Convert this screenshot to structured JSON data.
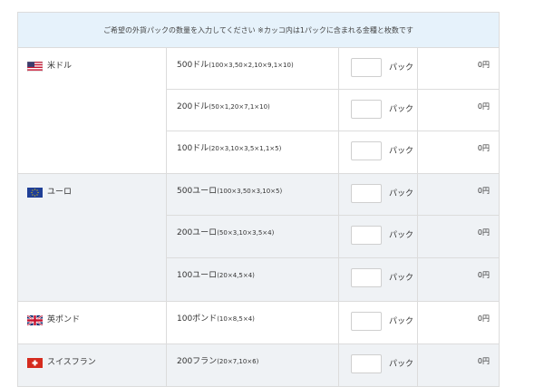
{
  "notice": "ご希望の外貨パックの数量を入力してください ※カッコ内は1パックに含まれる金種と枚数です",
  "unit_label": "パック",
  "currencies": [
    {
      "name": "米ドル",
      "flag": "us-flag-icon",
      "packs": [
        {
          "label": "500ドル",
          "detail": "(100×3,50×2,10×9,1×10)",
          "amount": "0円"
        },
        {
          "label": "200ドル",
          "detail": "(50×1,20×7,1×10)",
          "amount": "0円"
        },
        {
          "label": "100ドル",
          "detail": "(20×3,10×3,5×1,1×5)",
          "amount": "0円"
        }
      ]
    },
    {
      "name": "ユーロ",
      "flag": "eu-flag-icon",
      "packs": [
        {
          "label": "500ユーロ",
          "detail": "(100×3,50×3,10×5)",
          "amount": "0円"
        },
        {
          "label": "200ユーロ",
          "detail": "(50×3,10×3,5×4)",
          "amount": "0円"
        },
        {
          "label": "100ユーロ",
          "detail": "(20×4,5×4)",
          "amount": "0円"
        }
      ]
    },
    {
      "name": "英ポンド",
      "flag": "uk-flag-icon",
      "packs": [
        {
          "label": "100ポンド",
          "detail": "(10×8,5×4)",
          "amount": "0円"
        }
      ]
    },
    {
      "name": "スイスフラン",
      "flag": "swiss-flag-icon",
      "packs": [
        {
          "label": "200フラン",
          "detail": "(20×7,10×6)",
          "amount": "0円"
        }
      ]
    }
  ]
}
